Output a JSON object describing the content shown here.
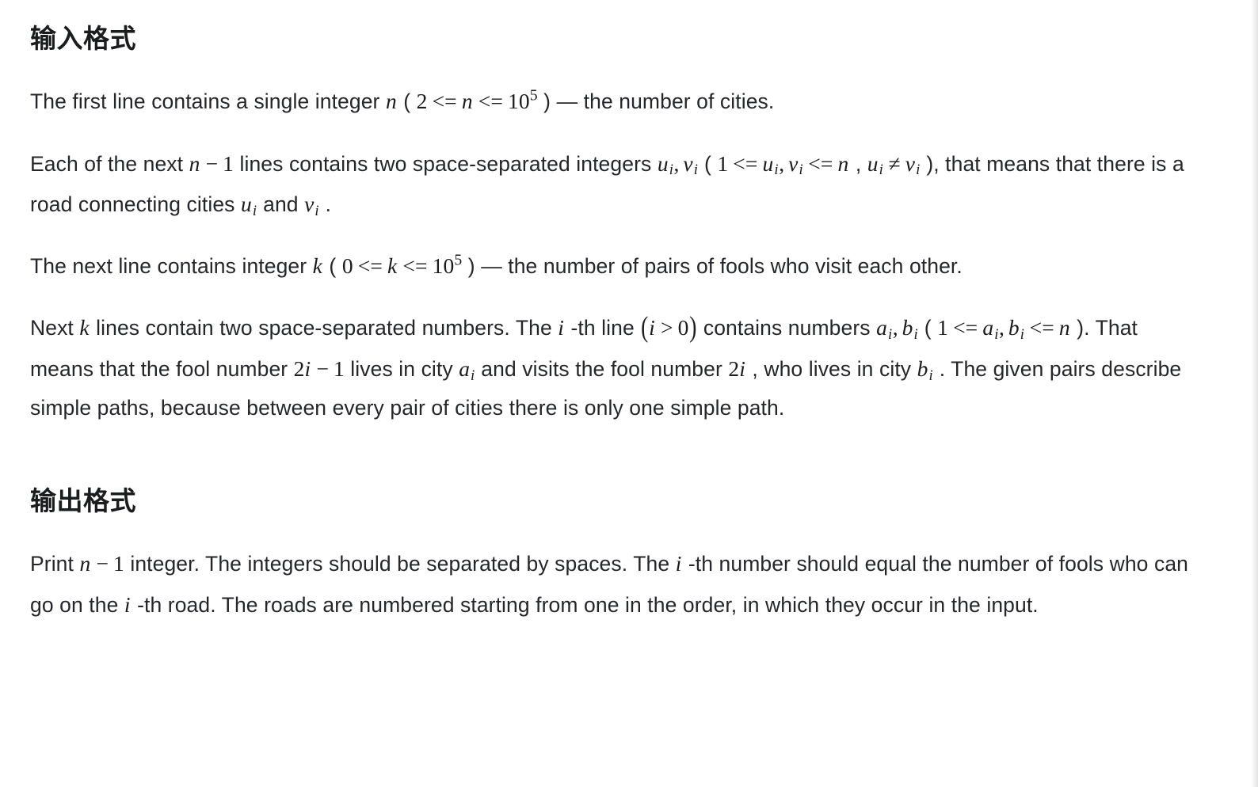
{
  "document": {
    "language": "zh-CN",
    "background_color": "#ffffff",
    "text_color": "#24262a",
    "heading_color": "#1b1c1e"
  },
  "sections": {
    "input": {
      "heading": "输入格式",
      "paragraphs": {
        "p1": {
          "t1": "The first line contains a single integer ",
          "m1_n": "n",
          "t2": " ( ",
          "m2_lo": "2",
          "m2_le1": "<=",
          "m2_n": "n",
          "m2_le2": "<=",
          "m2_base": "10",
          "m2_exp": "5",
          "t3": " ) ",
          "dash": "—",
          "t4": " the number of cities."
        },
        "p2": {
          "t1": "Each of the next ",
          "m1_n": "n",
          "m1_minus": "−",
          "m1_one": "1",
          "t2": " lines contains two space-separated integers ",
          "m2_u": "u",
          "m2_u_sub": "i",
          "m2_comma": ",",
          "m2_v": "v",
          "m2_v_sub": "i",
          "t3": " ( ",
          "m3_one": "1",
          "m3_le1": "<=",
          "m3_u": "u",
          "m3_u_sub": "i",
          "m3_comma": ",",
          "m3_v": "v",
          "m3_v_sub": "i",
          "m3_le2": "<=",
          "m3_n": "n",
          "t4": " , ",
          "m4_u": "u",
          "m4_u_sub": "i",
          "m4_neq": "≠",
          "m4_v": "v",
          "m4_v_sub": "i",
          "t5": " ), that means that there is a road connecting cities ",
          "m5_u": "u",
          "m5_u_sub": "i",
          "t6": " and ",
          "m6_v": "v",
          "m6_v_sub": "i",
          "t7": " ."
        },
        "p3": {
          "t1": "The next line contains integer ",
          "m1_k": "k",
          "t2": " ( ",
          "m2_zero": "0",
          "m2_le1": "<=",
          "m2_k": "k",
          "m2_le2": "<=",
          "m2_base": "10",
          "m2_exp": "5",
          "t3": " ) ",
          "dash": "—",
          "t4": " the number of pairs of fools who visit each other."
        },
        "p4": {
          "t1": "Next ",
          "m1_k": "k",
          "t2": " lines contain two space-separated numbers. The ",
          "m2_i": "i",
          "t3": " -th line ",
          "m3_open": "(",
          "m3_i": "i",
          "m3_gt": ">",
          "m3_zero": "0",
          "m3_close": ")",
          "t4": " contains numbers ",
          "m4_a": "a",
          "m4_a_sub": "i",
          "m4_comma": ",",
          "m4_b": "b",
          "m4_b_sub": "i",
          "t5": " ( ",
          "m5_one": "1",
          "m5_le1": "<=",
          "m5_a": "a",
          "m5_a_sub": "i",
          "m5_comma": ",",
          "m5_b": "b",
          "m5_b_sub": "i",
          "m5_le2": "<=",
          "m5_n": "n",
          "t6": " ). That means that the fool number ",
          "m6_two": "2",
          "m6_i": "i",
          "m6_minus": "−",
          "m6_one": "1",
          "t7": " lives in city ",
          "m7_a": "a",
          "m7_a_sub": "i",
          "t8": " and visits the fool number ",
          "m8_two": "2",
          "m8_i": "i",
          "t9": " , who lives in city ",
          "m9_b": "b",
          "m9_b_sub": "i",
          "t10": " . The given pairs describe simple paths, because between every pair of cities there is only one simple path."
        }
      }
    },
    "output": {
      "heading": "输出格式",
      "paragraphs": {
        "p5": {
          "t1": "Print ",
          "m1_n": "n",
          "m1_minus": "−",
          "m1_one": "1",
          "t2": " integer. The integers should be separated by spaces. The ",
          "m2_i": "i",
          "t3": " -th number should equal the number of fools who can go on the ",
          "m3_i": "i",
          "t4": " -th road. The roads are numbered starting from one in the order, in which they occur in the input."
        }
      }
    }
  }
}
